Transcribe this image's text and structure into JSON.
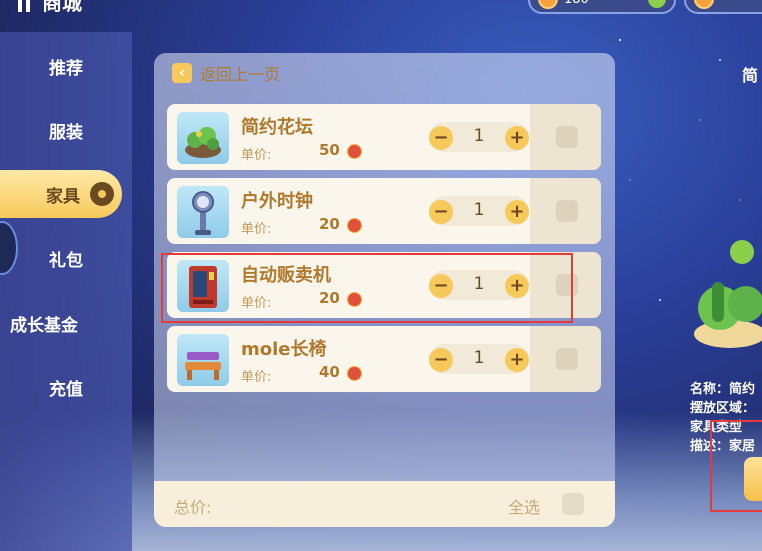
{
  "header": {
    "title": "商城",
    "currency1_amount": "180"
  },
  "sidebar": {
    "items": [
      {
        "label": "推荐"
      },
      {
        "label": "服装"
      },
      {
        "label": "家具"
      },
      {
        "label": "礼包"
      },
      {
        "label": "成长基金"
      },
      {
        "label": "充值"
      }
    ],
    "active_index": 2
  },
  "panel": {
    "back_label": "返回上一页",
    "price_label": "单价:",
    "items": [
      {
        "name": "简约花坛",
        "price": "50",
        "qty": "1"
      },
      {
        "name": "户外时钟",
        "price": "20",
        "qty": "1"
      },
      {
        "name": "自动贩卖机",
        "price": "20",
        "qty": "1"
      },
      {
        "name": "mole长椅",
        "price": "40",
        "qty": "1"
      }
    ],
    "footer": {
      "total_label": "总价:",
      "select_all_label": "全选"
    }
  },
  "preview": {
    "title": "简",
    "detail_lines": [
      "名称：简约",
      "摆放区域：",
      "家具类型",
      "描述：家居"
    ]
  },
  "colors": {
    "accent": "#f7c95a",
    "text_brown": "#b07a2e",
    "highlight": "#e33a3a"
  }
}
